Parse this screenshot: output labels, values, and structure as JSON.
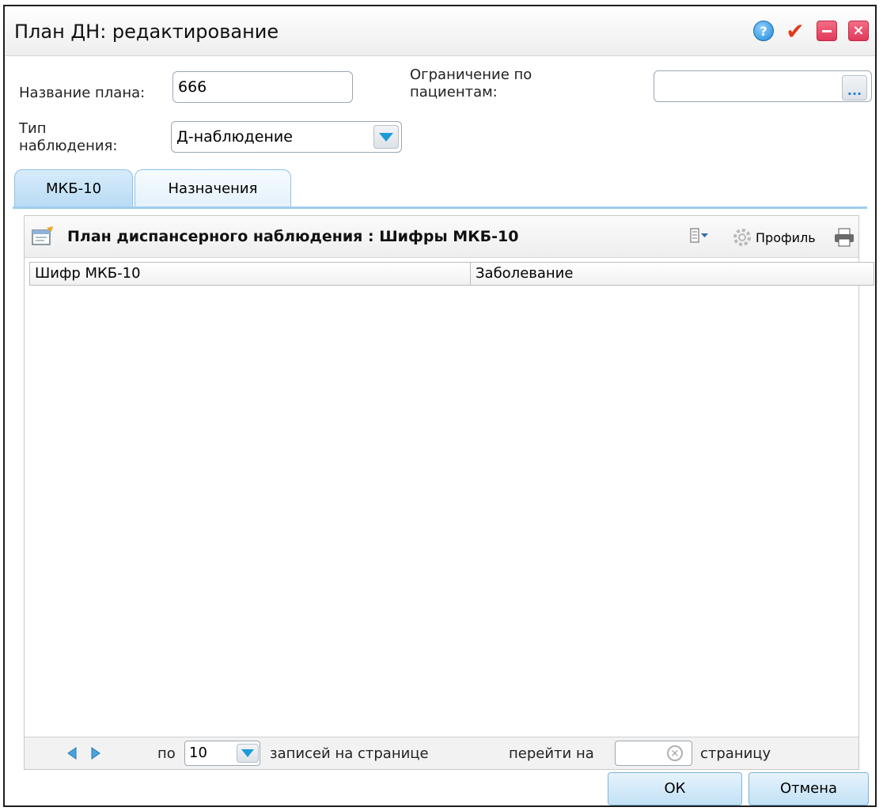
{
  "window": {
    "title": "План ДН: редактирование",
    "accent": "#1e9bd7",
    "close_color": "#e1385a"
  },
  "form": {
    "plan_name_label": "Название плана:",
    "plan_name_value": "666",
    "restriction_label_line1": "Ограничение по",
    "restriction_label_line2": "пациентам:",
    "restriction_value": "",
    "restriction_button": "...",
    "type_label_line1": "Тип",
    "type_label_line2": "наблюдения:",
    "type_value": "Д-наблюдение"
  },
  "tabs": [
    {
      "label": "МКБ-10",
      "active": true
    },
    {
      "label": "Назначения",
      "active": false
    }
  ],
  "grid": {
    "title": "План диспансерного наблюдения : Шифры МКБ-10",
    "profile_label": "Профиль",
    "columns": [
      "Шифр МКБ-10",
      "Заболевание"
    ],
    "rows": []
  },
  "paging": {
    "per_label": "по",
    "per_value": "10",
    "records_label": "записей на странице",
    "goto_label": "перейти на",
    "goto_value": "",
    "page_label": "страницу"
  },
  "buttons": {
    "ok": "ОК",
    "cancel": "Отмена"
  }
}
